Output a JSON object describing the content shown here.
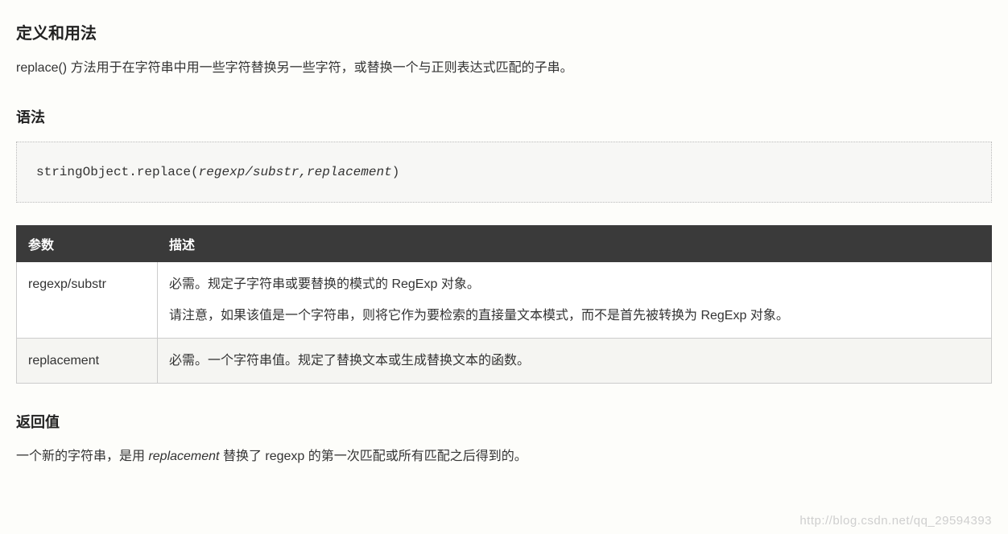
{
  "headings": {
    "definition": "定义和用法",
    "syntax": "语法",
    "returnValue": "返回值"
  },
  "definition_desc": "replace() 方法用于在字符串中用一些字符替换另一些字符，或替换一个与正则表达式匹配的子串。",
  "syntax_code": {
    "prefix": "stringObject.replace(",
    "args": "regexp/substr,replacement",
    "suffix": ")"
  },
  "table": {
    "headers": {
      "param": "参数",
      "desc": "描述"
    },
    "rows": [
      {
        "param": "regexp/substr",
        "desc_p1": "必需。规定子字符串或要替换的模式的 RegExp 对象。",
        "desc_p2": "请注意，如果该值是一个字符串，则将它作为要检索的直接量文本模式，而不是首先被转换为 RegExp 对象。"
      },
      {
        "param": "replacement",
        "desc_p1": "必需。一个字符串值。规定了替换文本或生成替换文本的函数。",
        "desc_p2": ""
      }
    ]
  },
  "return_desc": {
    "pre": "一个新的字符串，是用 ",
    "italic": "replacement",
    "post": " 替换了 regexp 的第一次匹配或所有匹配之后得到的。"
  },
  "watermark": "http://blog.csdn.net/qq_29594393"
}
